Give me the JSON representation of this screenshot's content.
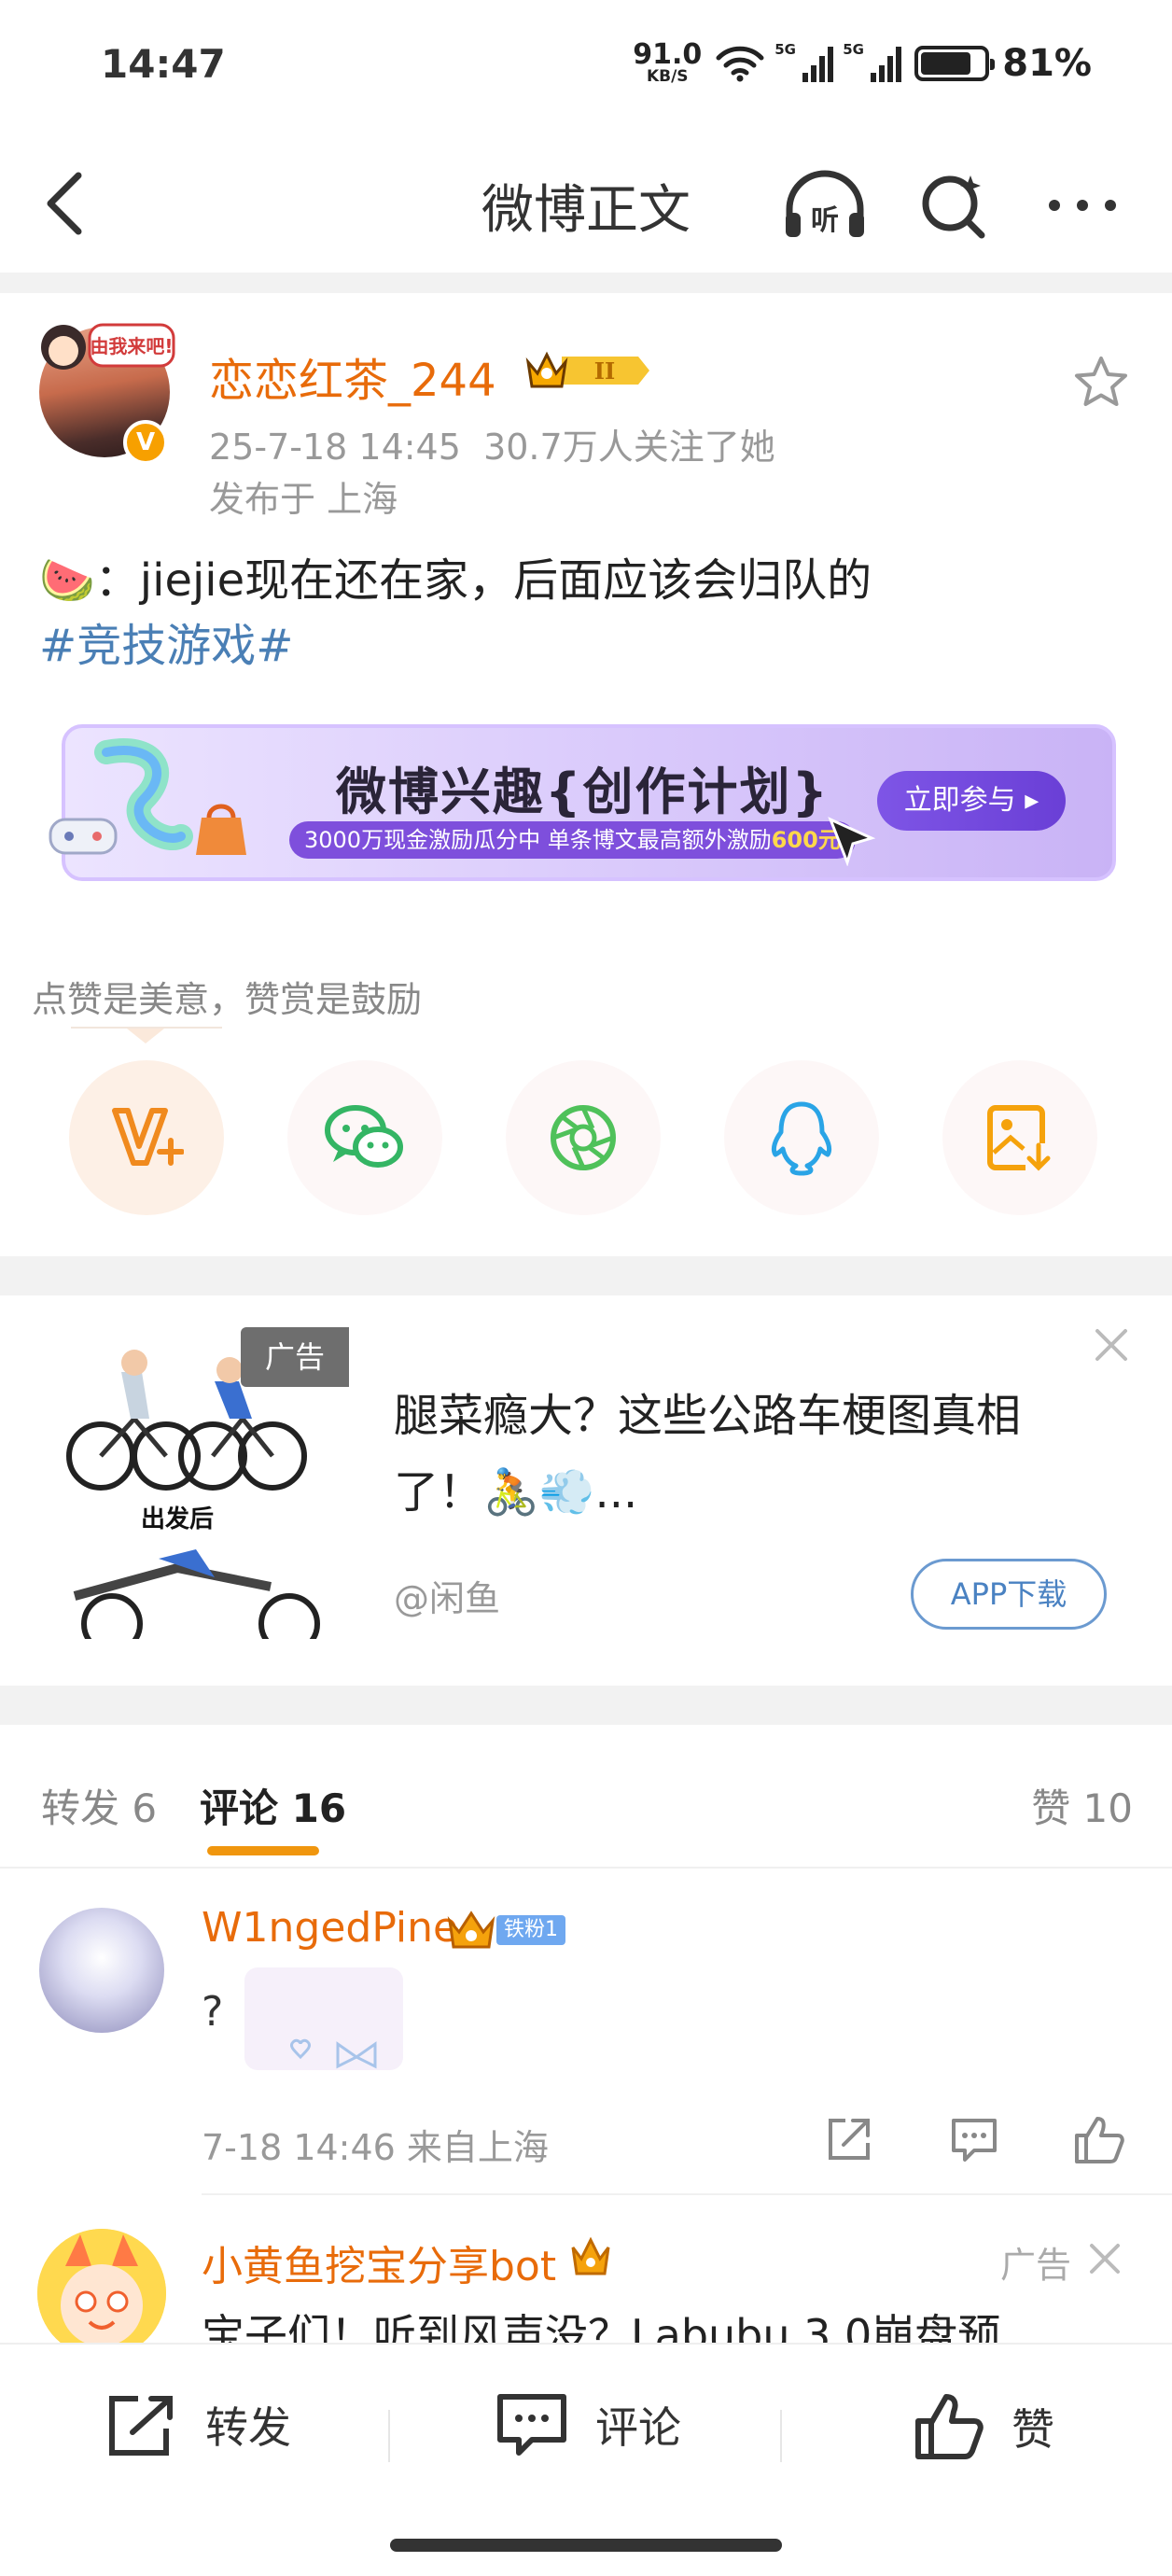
{
  "status_bar": {
    "time": "14:47",
    "speed_value": "91.0",
    "speed_unit": "KB/S",
    "network1": "5G",
    "network2": "5G",
    "battery": "81%"
  },
  "nav": {
    "title": "微博正文",
    "listen_label": "听"
  },
  "post": {
    "username": "恋恋红茶_244",
    "badge_level": "II",
    "verified_mark": "V",
    "avatar_sticker": "由我来吧!",
    "timestamp": "25-7-18 14:45",
    "followers": "30.7万人关注了她",
    "location": "发布于 上海",
    "emoji": "🍉",
    "text": "：jiejie现在还在家，后面应该会归队的",
    "topic": "#竞技游戏#"
  },
  "banner": {
    "title": "微博兴趣{创作计划}",
    "subtitle_prefix": "3000万现金激励瓜分中 单条博文最高额外激励",
    "subtitle_amount": "600元",
    "button": "立即参与 ▸"
  },
  "reward": {
    "hint": "点赞是美意，赞赏是鼓励"
  },
  "share_icons": [
    "vplus-icon",
    "wechat-icon",
    "moments-icon",
    "qq-icon",
    "save-image-icon"
  ],
  "ad": {
    "tag": "广告",
    "image_caption": "出发后",
    "title": "腿菜瘾大？这些公路车梗图真相了！🚴💨...",
    "source": "@闲鱼",
    "button": "APP下载"
  },
  "tabs": {
    "repost": "转发 6",
    "comments": "评论 16",
    "likes": "赞 10"
  },
  "comments": [
    {
      "username": "W1ngedPine",
      "fan_badge": "铁粉1",
      "text": "?",
      "meta": "7-18 14:46  来自上海"
    },
    {
      "username": "小黄鱼挖宝分享bot",
      "ad_label": "广告",
      "text": "宝子们！听到风声没？Labubu 3.0崩盘预"
    }
  ],
  "bottom_bar": {
    "repost": "转发",
    "comment": "评论",
    "like": "赞"
  },
  "colors": {
    "accent_orange": "#e86b0a",
    "topic_blue": "#4a7fb5",
    "tab_indicator": "#f0960e"
  }
}
